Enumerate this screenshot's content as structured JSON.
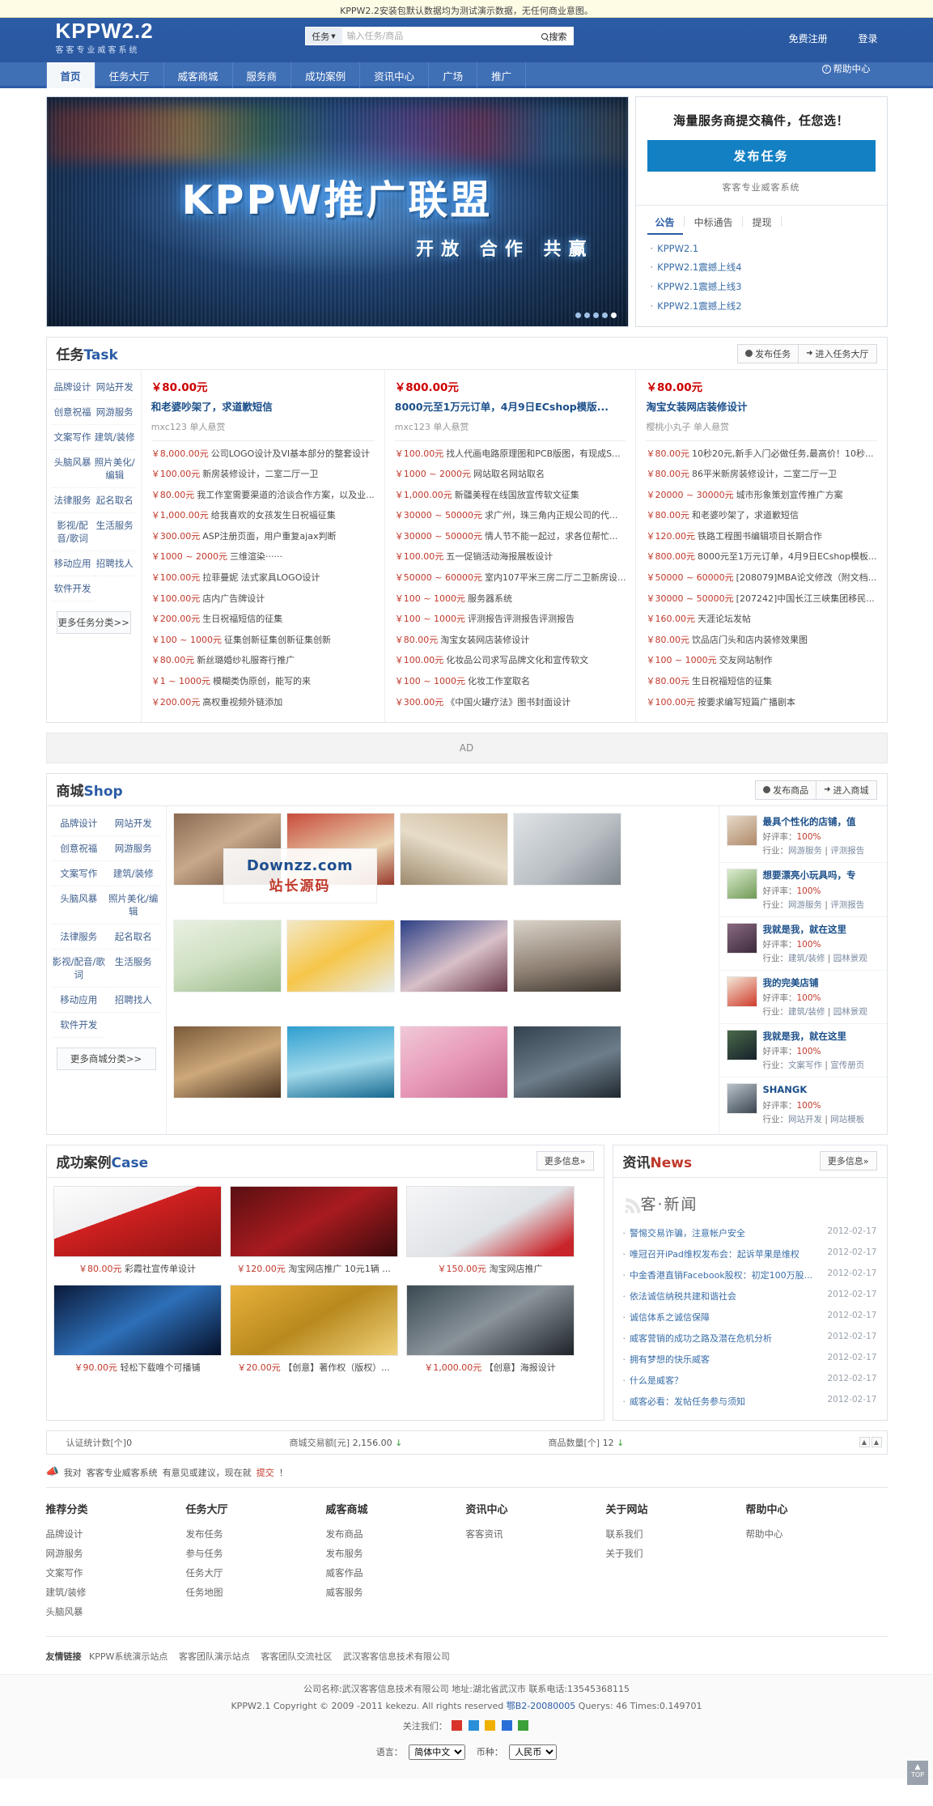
{
  "notice": "KPPW2.2安装包默认数据均为测试演示数据，无任何商业意图。",
  "header": {
    "logo_main": "KPPW2.2",
    "logo_sub": "客客专业威客系统",
    "search_category": "任务",
    "search_placeholder": "输入任务/商品",
    "search_button": "搜索",
    "register": "免费注册",
    "login": "登录"
  },
  "nav": {
    "items": [
      {
        "label": "首页",
        "active": true
      },
      {
        "label": "任务大厅",
        "active": false
      },
      {
        "label": "威客商城",
        "active": false
      },
      {
        "label": "服务商",
        "active": false
      },
      {
        "label": "成功案例",
        "active": false
      },
      {
        "label": "资讯中心",
        "active": false
      },
      {
        "label": "广场",
        "active": false
      },
      {
        "label": "推广",
        "active": false
      }
    ],
    "help": "帮助中心"
  },
  "banner": {
    "title": "KPPW推广联盟",
    "subtitle": "开放 合作 共赢",
    "dots": 5,
    "active_dot": 4
  },
  "promo": {
    "headline": "海量服务商提交稿件，任您选！",
    "button": "发布任务",
    "tagline": "客客专业威客系统",
    "tabs": [
      {
        "label": "公告",
        "active": true
      },
      {
        "label": "中标通告",
        "active": false
      },
      {
        "label": "提现",
        "active": false
      }
    ],
    "items": [
      "KPPW2.1",
      "KPPW2.1震撼上线4",
      "KPPW2.1震撼上线3",
      "KPPW2.1震撼上线2"
    ]
  },
  "task": {
    "title_cn": "任务",
    "title_en": "Task",
    "btn_post": "发布任务",
    "btn_hall": "进入任务大厅",
    "categories": [
      "品牌设计",
      "网站开发",
      "创意祝福",
      "网游服务",
      "文案写作",
      "建筑/装修",
      "头脑风暴",
      "照片美化/编辑",
      "法律服务",
      "起名取名",
      "影视/配音/歌词",
      "生活服务",
      "移动应用",
      "招聘找人",
      "软件开发"
    ],
    "more": "更多任务分类>>",
    "columns": [
      {
        "feat_price": "￥80.00元",
        "feat_title": "和老婆吵架了，求道歉短信",
        "feat_user": "mxc123 单人悬赏",
        "items": [
          {
            "price": "￥8,000.00元",
            "name": "公司LOGO设计及VI基本部分的整套设计"
          },
          {
            "price": "￥100.00元",
            "name": "新房装修设计，二室二厅一卫"
          },
          {
            "price": "￥80.00元",
            "name": "我工作室需要渠道的洽谈合作方案，以及业..."
          },
          {
            "price": "￥1,000.00元",
            "name": "给我喜欢的女孩发生日祝福征集"
          },
          {
            "price": "￥300.00元",
            "name": "ASP注册页面，用户重复ajax判断"
          },
          {
            "price": "￥1000 ~ 2000元",
            "name": "三维渲染······"
          },
          {
            "price": "￥100.00元",
            "name": "拉菲曼妮 法式家具LOGO设计"
          },
          {
            "price": "￥100.00元",
            "name": "店内广告牌设计"
          },
          {
            "price": "￥200.00元",
            "name": "生日祝福短信的征集"
          },
          {
            "price": "￥100 ~ 1000元",
            "name": "征集创新征集创新征集创新"
          },
          {
            "price": "￥80.00元",
            "name": "新丝璐婚纱礼服寄行推广"
          },
          {
            "price": "￥1 ~ 1000元",
            "name": "模糊类伪原创，能写的来"
          },
          {
            "price": "￥200.00元",
            "name": "高权重视频外链添加"
          }
        ]
      },
      {
        "feat_price": "￥800.00元",
        "feat_title": "8000元至1万元订单，4月9日ECshop模版...",
        "feat_user": "mxc123 单人悬赏",
        "items": [
          {
            "price": "￥100.00元",
            "name": "找人代画电路原理图和PCB版图，有现成S..."
          },
          {
            "price": "￥1000 ~ 2000元",
            "name": "网站取名网站取名"
          },
          {
            "price": "￥1,000.00元",
            "name": "新疆美程在线国放宣传软文征集"
          },
          {
            "price": "￥30000 ~ 50000元",
            "name": "求广州，珠三角内正规公司的代..."
          },
          {
            "price": "￥30000 ~ 50000元",
            "name": "情人节不能一起过，求各位帮忙..."
          },
          {
            "price": "￥100.00元",
            "name": "五一促销活动海报展板设计"
          },
          {
            "price": "￥50000 ~ 60000元",
            "name": "室内107平米三房二厅二卫新房设..."
          },
          {
            "price": "￥100 ~ 1000元",
            "name": "服务器系统"
          },
          {
            "price": "￥100 ~ 1000元",
            "name": "评测报告评测报告评测报告"
          },
          {
            "price": "￥80.00元",
            "name": "淘宝女装网店装修设计"
          },
          {
            "price": "￥100.00元",
            "name": "化妆品公司求写品牌文化和宣传软文"
          },
          {
            "price": "￥100 ~ 1000元",
            "name": "化妆工作室取名"
          },
          {
            "price": "￥300.00元",
            "name": "《中国火罐疗法》图书封面设计"
          }
        ]
      },
      {
        "feat_price": "￥80.00元",
        "feat_title": "淘宝女装网店装修设计",
        "feat_user": "樱桃小丸子 单人悬赏",
        "items": [
          {
            "price": "￥80.00元",
            "name": "10秒20元,新手入门必做任务,最高价！10秒..."
          },
          {
            "price": "￥80.00元",
            "name": "86平米新房装修设计，二室二厅一卫"
          },
          {
            "price": "￥20000 ~ 30000元",
            "name": "城市形象策划宣传推广方案"
          },
          {
            "price": "￥80.00元",
            "name": "和老婆吵架了，求道歉短信"
          },
          {
            "price": "￥120.00元",
            "name": "铁路工程图书编辑项目长期合作"
          },
          {
            "price": "￥800.00元",
            "name": "8000元至1万元订单，4月9日ECshop模板..."
          },
          {
            "price": "￥50000 ~ 60000元",
            "name": "[208079]MBA论文修改（附文档..."
          },
          {
            "price": "￥30000 ~ 50000元",
            "name": "[207242]中国长江三峡集团移民..."
          },
          {
            "price": "￥160.00元",
            "name": "天涯论坛发帖"
          },
          {
            "price": "￥80.00元",
            "name": "饮品店门头和店内装修效果图"
          },
          {
            "price": "￥100 ~ 1000元",
            "name": "交友网站制作"
          },
          {
            "price": "￥80.00元",
            "name": "生日祝福短信的征集"
          },
          {
            "price": "￥100.00元",
            "name": "按要求编写短篇广播剧本"
          }
        ]
      }
    ]
  },
  "ad": {
    "label": "AD"
  },
  "shop": {
    "title_cn": "商城",
    "title_en": "Shop",
    "btn_post": "发布商品",
    "btn_enter": "进入商城",
    "categories": [
      "品牌设计",
      "网站开发",
      "创意祝福",
      "网游服务",
      "文案写作",
      "建筑/装修",
      "头脑风暴",
      "照片美化/编辑",
      "法律服务",
      "起名取名",
      "影视/配音/歌词",
      "生活服务",
      "移动应用",
      "招聘找人",
      "软件开发"
    ],
    "more": "更多商城分类>>",
    "watermark_line1": "Downzz.com",
    "watermark_line2": "站长源码",
    "items": [
      {
        "name": "最具个性化的店铺，值",
        "rate_label": "好评率：",
        "rate": "100%",
        "industry_label": "行业：",
        "industry": "网游服务",
        "tag": "评测报告"
      },
      {
        "name": "想要漂亮小玩具吗，专",
        "rate_label": "好评率：",
        "rate": "100%",
        "industry_label": "行业：",
        "industry": "网游服务",
        "tag": "评测报告"
      },
      {
        "name": "我就是我，就在这里",
        "rate_label": "好评率：",
        "rate": "100%",
        "industry_label": "行业：",
        "industry": "建筑/装修",
        "tag": "园林景观"
      },
      {
        "name": "我的完美店铺",
        "rate_label": "好评率：",
        "rate": "100%",
        "industry_label": "行业：",
        "industry": "建筑/装修",
        "tag": "园林景观"
      },
      {
        "name": "我就是我，就在这里",
        "rate_label": "好评率：",
        "rate": "100%",
        "industry_label": "行业：",
        "industry": "文案写作",
        "tag": "宣传册页"
      },
      {
        "name": "SHANGK",
        "rate_label": "好评率：",
        "rate": "100%",
        "industry_label": "行业：",
        "industry": "网站开发",
        "tag": "网站模板"
      }
    ]
  },
  "cases": {
    "title_cn": "成功案例",
    "title_en": "Case",
    "more": "更多信息»",
    "items": [
      {
        "price": "￥80.00元",
        "name": "彩霞社宣传单设计"
      },
      {
        "price": "￥120.00元",
        "name": "淘宝网店推广 10元1辆 ..."
      },
      {
        "price": "￥150.00元",
        "name": "淘宝网店推广"
      },
      {
        "price": "￥90.00元",
        "name": "轻松下载唯个可播铺"
      },
      {
        "price": "￥20.00元",
        "name": "【创意】著作权（版权）..."
      },
      {
        "price": "￥1,000.00元",
        "name": "【创意】海报设计"
      }
    ]
  },
  "news": {
    "title_cn": "资讯",
    "title_en": "News",
    "more": "更多信息»",
    "logo_text": "客·新闻",
    "items": [
      {
        "title": "警惕交易诈骗，注意帐户安全",
        "date": "2012-02-17"
      },
      {
        "title": "唯冠召开iPad维权发布会：起诉苹果是维权",
        "date": "2012-02-17"
      },
      {
        "title": "中金香港直销Facebook股权：初定100万股...",
        "date": "2012-02-17"
      },
      {
        "title": "依法诚信纳税共建和谐社会",
        "date": "2012-02-17"
      },
      {
        "title": "诚信体系之诚信保障",
        "date": "2012-02-17"
      },
      {
        "title": "威客营销的成功之路及潜在危机分析",
        "date": "2012-02-17"
      },
      {
        "title": "拥有梦想的快乐威客",
        "date": "2012-02-17"
      },
      {
        "title": "什么是威客？",
        "date": "2012-02-17"
      },
      {
        "title": "威客必看：发帖任务参与须知",
        "date": "2012-02-17"
      }
    ]
  },
  "stats": {
    "c1_label": "认证统计数[个]",
    "c1_value": "0",
    "c2_label": "商城交易额[元]",
    "c2_value": "2,156.00",
    "c3_label": "商品数量[个]",
    "c3_value": "12",
    "pager_up": "▲",
    "pager_down": "▲"
  },
  "feedback": {
    "prefix": "我对",
    "site": "客客专业威客系统",
    "mid": "有意见或建议，现在就",
    "link": "提交",
    "suffix": "！"
  },
  "footer": {
    "columns": [
      {
        "title": "推荐分类",
        "links": [
          "品牌设计",
          "网游服务",
          "文案写作",
          "建筑/装修",
          "头脑风暴"
        ]
      },
      {
        "title": "任务大厅",
        "links": [
          "发布任务",
          "参与任务",
          "任务大厅",
          "任务地图"
        ]
      },
      {
        "title": "威客商城",
        "links": [
          "发布商品",
          "发布服务",
          "威客作品",
          "威客服务"
        ]
      },
      {
        "title": "资讯中心",
        "links": [
          "客客资讯"
        ]
      },
      {
        "title": "关于网站",
        "links": [
          "联系我们",
          "关于我们"
        ]
      },
      {
        "title": "帮助中心",
        "links": [
          "帮助中心"
        ]
      }
    ],
    "friendlinks_label": "友情链接",
    "friendlinks": [
      "KPPW系统演示站点",
      "客客团队演示站点",
      "客客团队交流社区",
      "武汉客客信息技术有限公司"
    ],
    "company": "公司名称:武汉客客信息技术有限公司  地址:湖北省武汉市    联系电话:13545368115",
    "copyright_prefix": "KPPW2.1 Copyright © 2009 -2011 kekezu. All rights reserved",
    "icp": "鄂B2-20080005",
    "querys": "Querys: 46",
    "times": "Times:0.149701",
    "follow_label": "关注我们：",
    "lang_label": "语言：",
    "lang_value": "简体中文",
    "currency_label": "币种：",
    "currency_value": "人民币",
    "totop": "TOP"
  }
}
